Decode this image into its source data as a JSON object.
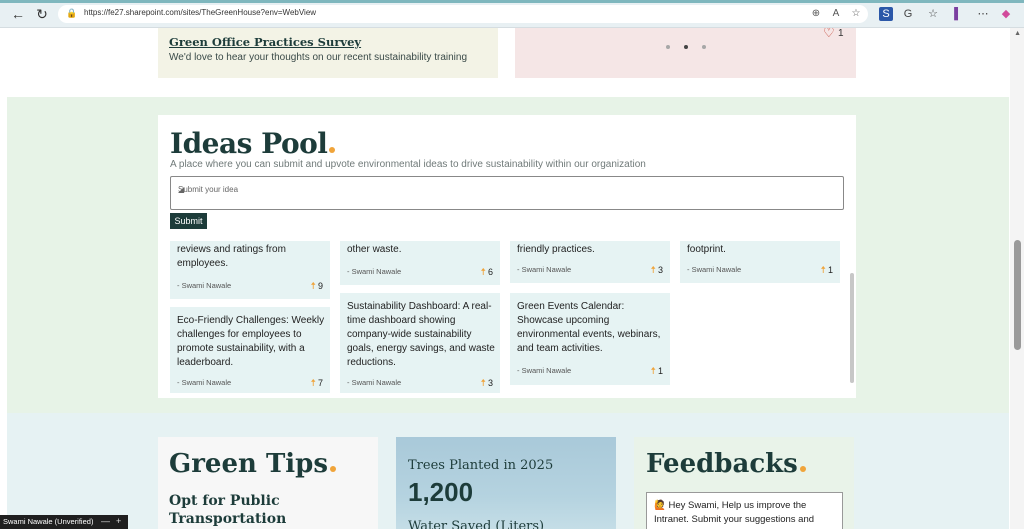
{
  "browser": {
    "url": "https://fe27.sharepoint.com/sites/TheGreenHouse?env=WebView"
  },
  "top_cards": {
    "survey_title": "Green Office Practices Survey",
    "survey_desc": "We'd love to hear your thoughts on our recent sustainability training",
    "likes": "1"
  },
  "ideas": {
    "title": "Ideas Pool",
    "subtitle": "A place where you can submit and upvote environmental ideas to drive sustainability within our organization",
    "input_placeholder": "Submit your idea",
    "submit_label": "Submit",
    "items": [
      {
        "text": "reviews and ratings from employees.",
        "author": "- Swami Nawale",
        "votes": "9"
      },
      {
        "text": "other waste.",
        "author": "- Swami Nawale",
        "votes": "6"
      },
      {
        "text": "friendly practices.",
        "author": "- Swami Nawale",
        "votes": "3"
      },
      {
        "text": "footprint.",
        "author": "- Swami Nawale",
        "votes": "1"
      },
      {
        "text": "Eco-Friendly Challenges: Weekly challenges for employees to promote sustainability, with a leaderboard.",
        "author": "- Swami Nawale",
        "votes": "7"
      },
      {
        "text": "Sustainability Dashboard: A real-time dashboard showing company-wide sustainability goals, energy savings, and waste reductions.",
        "author": "- Swami Nawale",
        "votes": "3"
      },
      {
        "text": "Green Events Calendar: Showcase upcoming environmental events, webinars, and team activities.",
        "author": "- Swami Nawale",
        "votes": "1"
      }
    ]
  },
  "green_tips": {
    "title": "Green Tips",
    "item": "Opt for Public Transportation"
  },
  "stats": {
    "label": "Trees Planted in 2025",
    "value": "1,200",
    "label2": "Water Saved (Liters)"
  },
  "feedbacks": {
    "title": "Feedbacks",
    "message": "🙋 Hey Swami, Help us improve the Intranet. Submit your suggestions and"
  },
  "status": {
    "user": "Swami Nawale (Unverified)"
  }
}
